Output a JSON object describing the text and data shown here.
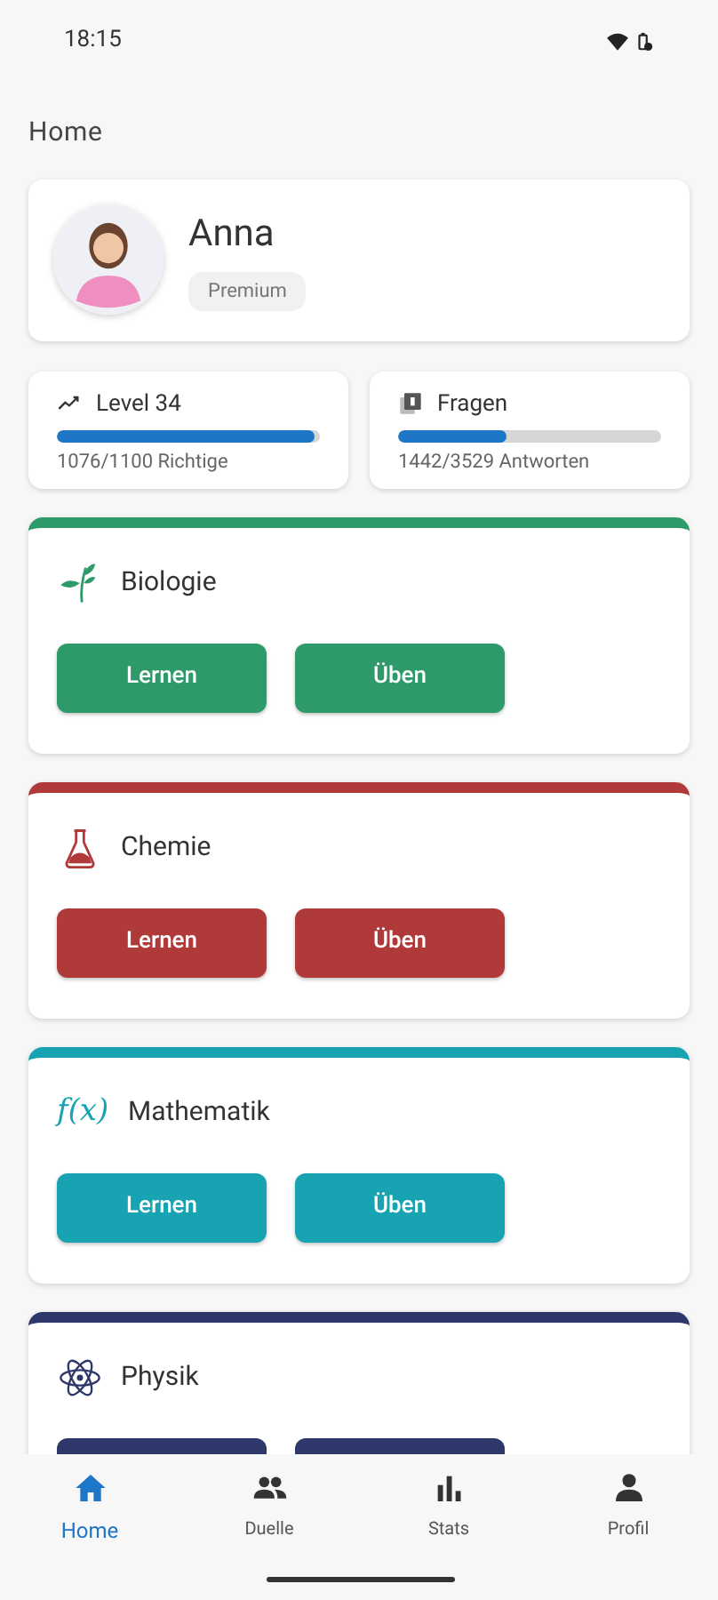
{
  "status_bar": {
    "time": "18:15"
  },
  "page_title": "Home",
  "profile": {
    "name": "Anna",
    "badge": "Premium"
  },
  "stats": [
    {
      "kind": "trend",
      "title": "Level 34",
      "level": 0.98,
      "caption": "1076/1100 Richtige"
    },
    {
      "kind": "questions",
      "title": "Fragen",
      "level": 0.41,
      "caption": "1442/3529 Antworten"
    }
  ],
  "subjects": [
    {
      "kind": "plant",
      "name": "Biologie",
      "color": "#2e9a6a",
      "buttons": [
        "Lernen",
        "Üben"
      ]
    },
    {
      "kind": "flask",
      "name": "Chemie",
      "color": "#b03a3a",
      "buttons": [
        "Lernen",
        "Üben"
      ]
    },
    {
      "kind": "symbol",
      "symbol": "f(x)",
      "name": "Mathematik",
      "color": "#17a3b1",
      "buttons": [
        "Lernen",
        "Üben"
      ]
    },
    {
      "kind": "atom",
      "name": "Physik",
      "color": "#2f386b",
      "button_tops_visible": true
    }
  ],
  "nav": [
    {
      "kind": "home",
      "label": "Home",
      "selected": true
    },
    {
      "kind": "people",
      "label": "Duelle",
      "selected": false
    },
    {
      "kind": "bars",
      "label": "Stats",
      "selected": false
    },
    {
      "kind": "person",
      "label": "Profil",
      "selected": false
    }
  ]
}
